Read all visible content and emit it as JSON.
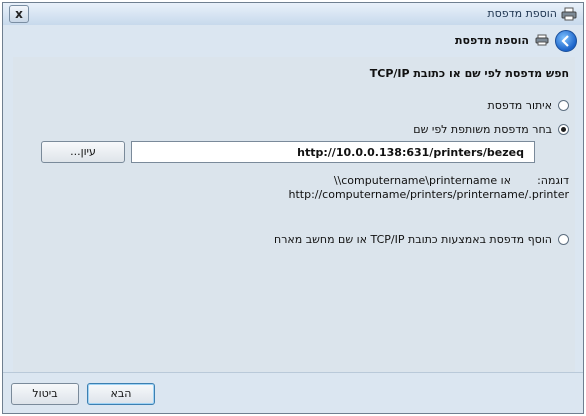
{
  "window": {
    "title": "הוספת מדפסת",
    "close_label": "x"
  },
  "header": {
    "title": "הוספת מדפסת"
  },
  "main": {
    "section_title": "חפש מדפסת לפי שם או כתובת TCP/IP",
    "options": [
      {
        "label": "איתור מדפסת",
        "selected": false
      },
      {
        "label": "בחר מדפסת משותפת לפי שם",
        "selected": true
      },
      {
        "label": "הוסף מדפסת באמצעות כתובת TCP/IP או שם מחשב מארח",
        "selected": false
      }
    ],
    "url_input_value": "http://10.0.0.138:631/printers/bezeq",
    "browse_label": "עיון...",
    "example_label": "דוגמה:",
    "example_line1": "\\\\computername\\printername או",
    "example_line2": "http://computername/printers/printername/.printer"
  },
  "footer": {
    "next_label": "הבא",
    "cancel_label": "ביטול"
  }
}
